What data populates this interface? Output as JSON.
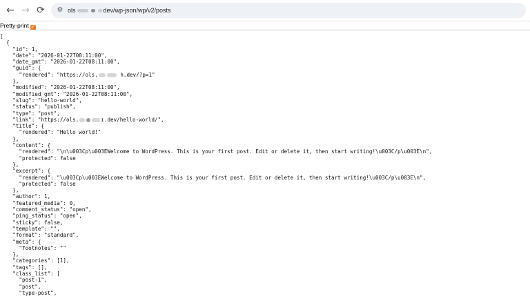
{
  "browser": {
    "nav": {
      "back_icon": "←",
      "forward_icon": "→",
      "reload_icon": "⟳"
    },
    "site_info_icon": "⚙",
    "url": {
      "host_visible": "ols",
      "path": "dev/wp-json/wp/v2/posts"
    }
  },
  "pretty_print": {
    "label": "Pretty-print",
    "checked": true,
    "check_glyph": "✓"
  },
  "json": {
    "open_bracket": "[",
    "open_object": "  {",
    "id": "    \"id\": 1,",
    "date": "    \"date\": \"2026-01-22T08:11:00\",",
    "date_gmt": "    \"date_gmt\": \"2026-01-22T08:11:00\",",
    "guid_open": "    \"guid\": {",
    "guid_rendered_a": "      \"rendered\": \"https://ols.",
    "guid_rendered_b": "h.dev/?p=1\"",
    "guid_close": "    },",
    "modified": "    \"modified\": \"2026-01-22T08:11:00\",",
    "modified_gmt": "    \"modified_gmt\": \"2026-01-22T08:11:00\",",
    "slug": "    \"slug\": \"hello-world\",",
    "status": "    \"status\": \"publish\",",
    "type": "    \"type\": \"post\",",
    "link_a": "    \"link\": \"https://ols.",
    "link_b": "ı.dev/hello-world/\",",
    "title_open": "    \"title\": {",
    "title_rendered": "      \"rendered\": \"Hello world!\"",
    "title_close": "    },",
    "content_open": "    \"content\": {",
    "content_rendered": "      \"rendered\": \"\\n\\u003Cp\\u003EWelcome to WordPress. This is your first post. Edit or delete it, then start writing!\\u003C/p\\u003E\\n\",",
    "content_protected": "      \"protected\": false",
    "content_close": "    },",
    "excerpt_open": "    \"excerpt\": {",
    "excerpt_rendered": "      \"rendered\": \"\\u003Cp\\u003EWelcome to WordPress. This is your first post. Edit or delete it, then start writing!\\u003C/p\\u003E\\n\",",
    "excerpt_protected": "      \"protected\": false",
    "excerpt_close": "    },",
    "author": "    \"author\": 1,",
    "featured_media": "    \"featured_media\": 0,",
    "comment_status": "    \"comment_status\": \"open\",",
    "ping_status": "    \"ping_status\": \"open\",",
    "sticky": "    \"sticky\": false,",
    "template": "    \"template\": \"\",",
    "format": "    \"format\": \"standard\",",
    "meta_open": "    \"meta\": {",
    "meta_footnotes": "      \"footnotes\": \"\"",
    "meta_close": "    },",
    "categories": "    \"categories\": [1],",
    "tags": "    \"tags\": [],",
    "class_list_open": "    \"class_list\": [",
    "class_1": "      \"post-1\",",
    "class_2": "      \"post\",",
    "class_3": "      \"type-post\","
  }
}
